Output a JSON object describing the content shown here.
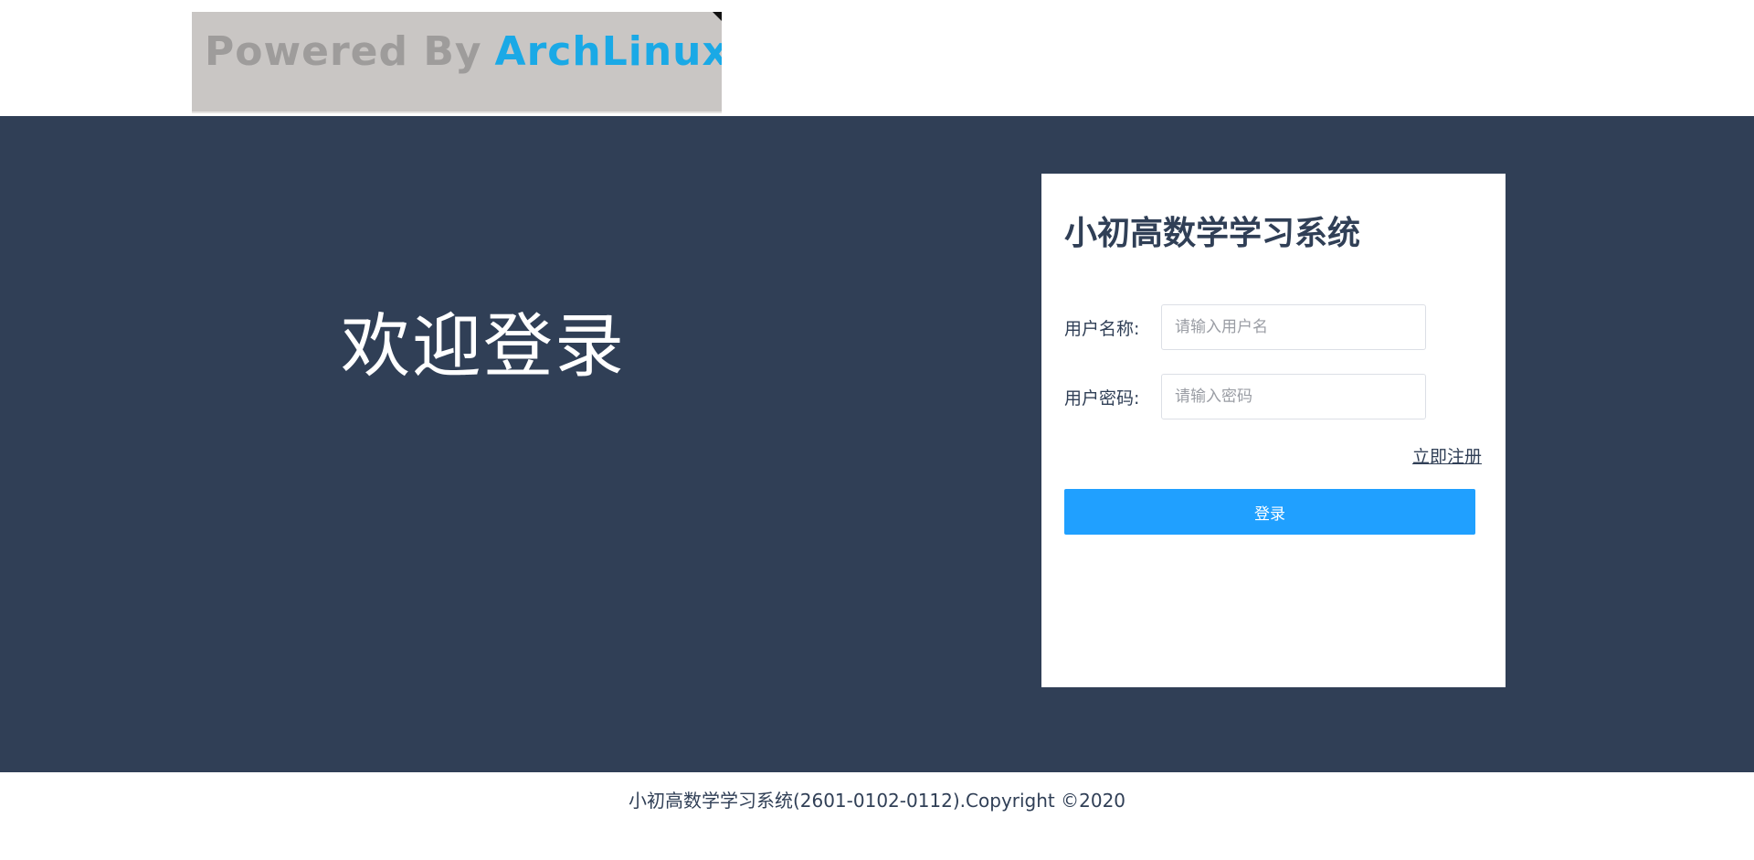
{
  "header": {
    "logo": {
      "powered_text": "Powered By",
      "brand_text": "ArchLinux"
    }
  },
  "hero": {
    "welcome_text": "欢迎登录"
  },
  "login_card": {
    "title": "小初高数学学习系统",
    "username": {
      "label": "用户名称:",
      "placeholder": "请输入用户名",
      "value": ""
    },
    "password": {
      "label": "用户密码:",
      "placeholder": "请输入密码",
      "value": ""
    },
    "register_link": "立即注册",
    "login_button": "登录"
  },
  "footer": {
    "text": "小初高数学学习系统(2601-0102-0112).Copyright ©2020"
  },
  "colors": {
    "hero_background": "#303f56",
    "primary_button": "#20a0ff",
    "logo_background": "#c9c6c4",
    "logo_brand": "#1aa9e6"
  }
}
